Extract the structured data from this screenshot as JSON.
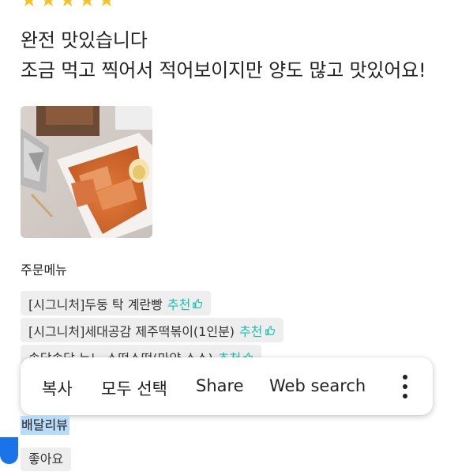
{
  "review": {
    "rating": 5,
    "star_color": "#f7c324",
    "lines": [
      "완전 맛있습니다",
      "조금 먹고 찍어서 적어보이지만 양도 많고 맛있어요!"
    ],
    "photo": "tteokbokki-with-egg"
  },
  "order_menu": {
    "label": "주문메뉴",
    "recommend_color": "#1ec0b0",
    "items": [
      {
        "name": "[시그니처]두둥 탁 계란빵",
        "recommend": "추천"
      },
      {
        "name": "[시그니처]세대공감 제주떡볶이(1인분)",
        "recommend": "추천"
      },
      {
        "name": "솔닭솔닭 누느 소떡소떡(마약 소스)",
        "recommend": "추천"
      }
    ]
  },
  "context_menu": {
    "copy": "복사",
    "select_all": "모두 선택",
    "share": "Share",
    "web_search": "Web search",
    "more_icon": "more-vertical-icon"
  },
  "selection": {
    "text": "배달리뷰",
    "highlight_color": "#b8dcf7",
    "handle_color": "#1a73e8"
  },
  "tags": {
    "first": "좋아요"
  }
}
